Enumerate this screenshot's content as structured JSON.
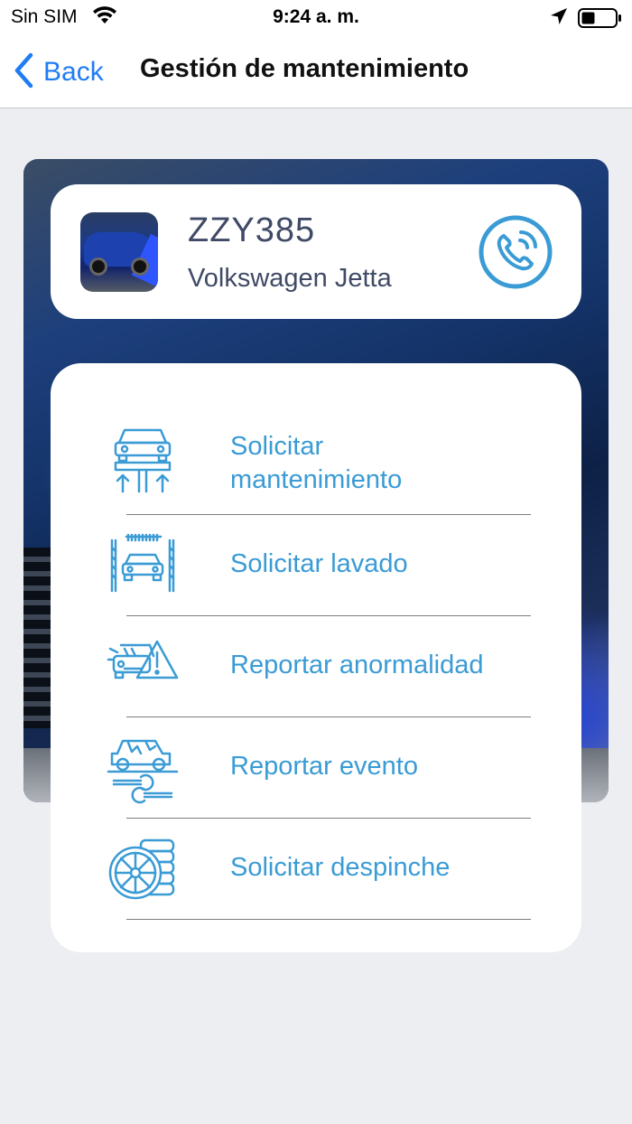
{
  "status_bar": {
    "carrier": "Sin SIM",
    "time": "9:24 a. m."
  },
  "nav": {
    "back_label": "Back",
    "title": "Gestión de mantenimiento"
  },
  "vehicle": {
    "plate": "ZZY385",
    "model": "Volkswagen Jetta"
  },
  "actions": [
    {
      "label": "Solicitar mantenimiento",
      "icon": "car-lift-icon"
    },
    {
      "label": "Solicitar lavado",
      "icon": "car-wash-icon"
    },
    {
      "label": "Reportar anormalidad",
      "icon": "car-warning-icon"
    },
    {
      "label": "Reportar evento",
      "icon": "damaged-car-wrench-icon"
    },
    {
      "label": "Solicitar despinche",
      "icon": "tires-icon"
    }
  ],
  "colors": {
    "accent": "#3a9bd5",
    "ios_blue": "#1f7cf5",
    "text_dark": "#404a66",
    "background": "#edeef2"
  }
}
